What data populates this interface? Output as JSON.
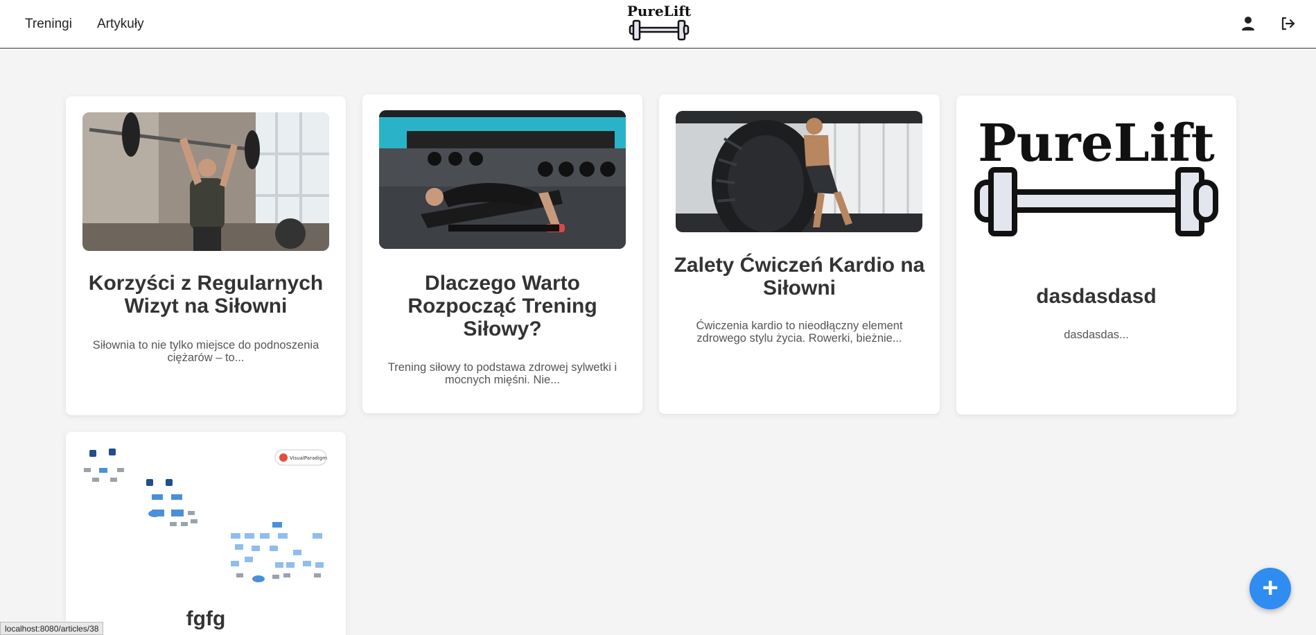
{
  "nav": {
    "links": [
      "Treningi",
      "Artykuły"
    ],
    "logo_text": "PureLift",
    "profile_icon": "user-icon",
    "logout_icon": "logout-icon"
  },
  "articles": [
    {
      "title": "Korzyści z Regularnych Wizyt na Siłowni",
      "desc": "Siłownia to nie tylko miejsce do podnoszenia ciężarów – to..."
    },
    {
      "title": "Dlaczego Warto Rozpocząć Trening Siłowy?",
      "desc": "Trening siłowy to podstawa zdrowej sylwetki i mocnych mięśni. Nie..."
    },
    {
      "title": "Zalety Ćwiczeń Kardio na Siłowni",
      "desc": "Ćwiczenia kardio to nieodłączny element zdrowego stylu życia. Rowerki, bieżnie..."
    },
    {
      "title": "dasdasdasd",
      "desc": "dasdasdas...",
      "logo_text": "PureLift"
    },
    {
      "title": "fgfg",
      "desc": "",
      "badge": "VisualParadigm"
    }
  ],
  "fab": {
    "label": "+"
  },
  "status_bar": {
    "url": "localhost:8080/articles/38"
  },
  "colors": {
    "accent": "#2f8cf0",
    "background": "#f4f4f4",
    "card": "#ffffff"
  }
}
